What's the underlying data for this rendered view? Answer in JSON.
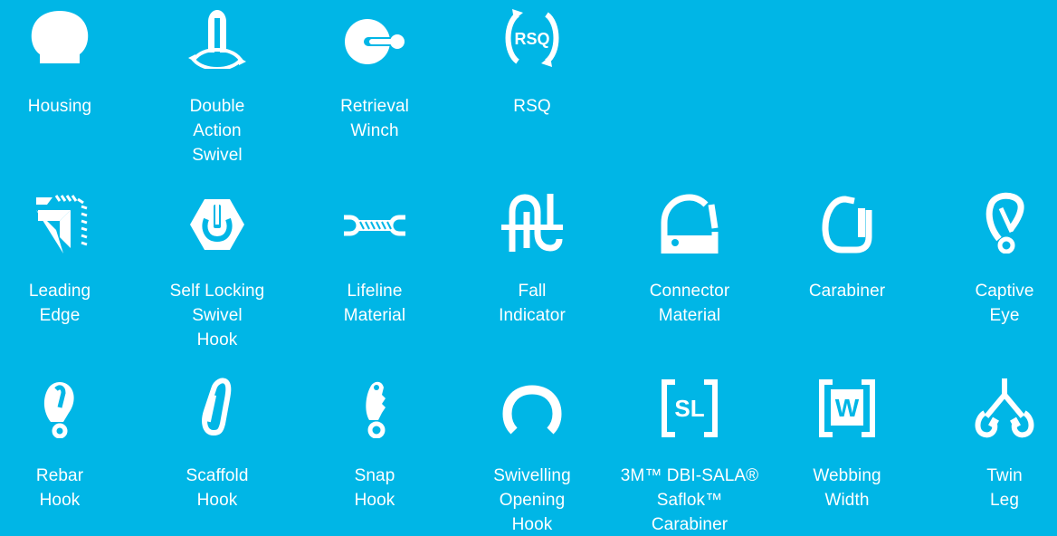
{
  "theme": {
    "background": "#00b6e6",
    "foreground": "#ffffff"
  },
  "icons": [
    {
      "name": "housing-icon",
      "label": [
        "Housing"
      ]
    },
    {
      "name": "double-action-swivel-icon",
      "label": [
        "Double",
        "Action",
        "Swivel"
      ]
    },
    {
      "name": "retrieval-winch-icon",
      "label": [
        "Retrieval",
        "Winch"
      ]
    },
    {
      "name": "rsq-icon",
      "icon_text": "RSQ",
      "label": [
        "RSQ"
      ]
    },
    {
      "name": "leading-edge-icon",
      "label": [
        "Leading",
        "Edge"
      ]
    },
    {
      "name": "self-locking-swivel-hook-icon",
      "label": [
        "Self Locking",
        "Swivel",
        "Hook"
      ]
    },
    {
      "name": "lifeline-material-icon",
      "label": [
        "Lifeline",
        "Material"
      ]
    },
    {
      "name": "fall-indicator-icon",
      "label": [
        "Fall",
        "Indicator"
      ]
    },
    {
      "name": "connector-material-icon",
      "label": [
        "Connector",
        "Material"
      ]
    },
    {
      "name": "carabiner-icon",
      "label": [
        "Carabiner"
      ]
    },
    {
      "name": "captive-eye-icon",
      "label": [
        "Captive",
        "Eye"
      ]
    },
    {
      "name": "rebar-hook-icon",
      "label": [
        "Rebar",
        "Hook"
      ]
    },
    {
      "name": "scaffold-hook-icon",
      "label": [
        "Scaffold",
        "Hook"
      ]
    },
    {
      "name": "snap-hook-icon",
      "label": [
        "Snap",
        "Hook"
      ]
    },
    {
      "name": "swivelling-opening-hook-icon",
      "label": [
        "Swivelling",
        "Opening",
        "Hook"
      ]
    },
    {
      "name": "dbi-sala-saflok-carabiner-icon",
      "icon_text": "SL",
      "label": [
        "3M™ DBI-SALA®",
        "Saflok™",
        "Carabiner"
      ]
    },
    {
      "name": "webbing-width-icon",
      "icon_text": "W",
      "label": [
        "Webbing",
        "Width"
      ]
    },
    {
      "name": "twin-leg-icon",
      "label": [
        "Twin",
        "Leg"
      ]
    }
  ]
}
